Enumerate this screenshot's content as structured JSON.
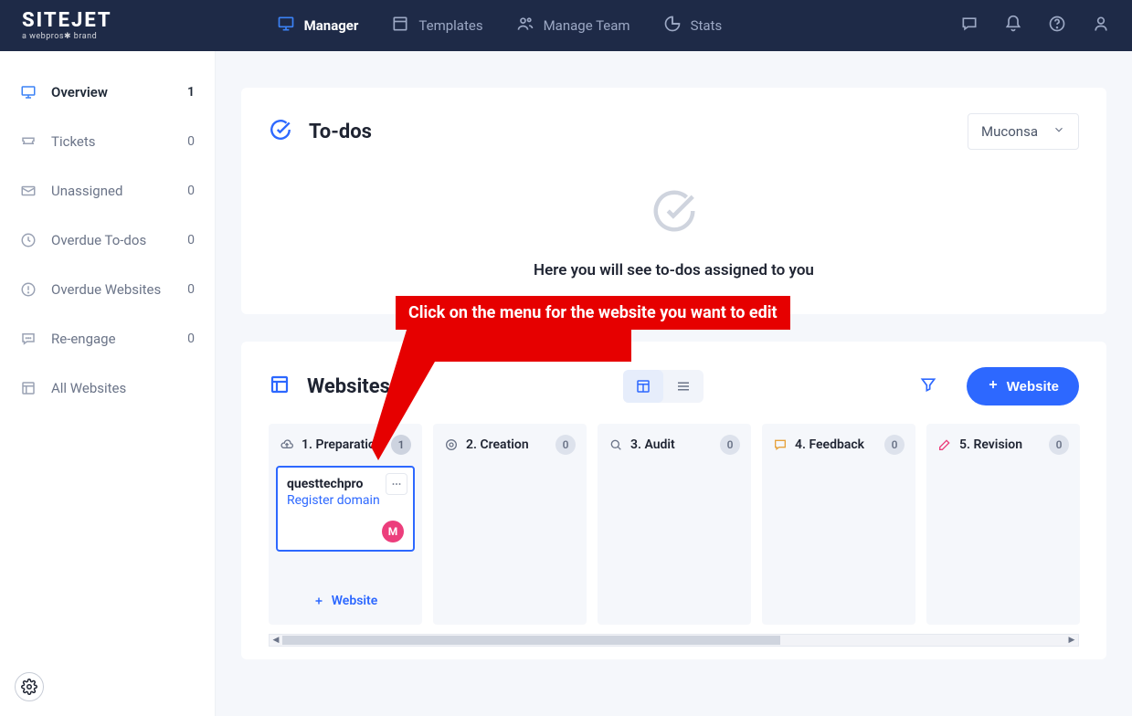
{
  "brand": {
    "name": "SITEJET",
    "sub": "a webpros✱ brand"
  },
  "topnav": {
    "items": [
      {
        "label": "Manager"
      },
      {
        "label": "Templates"
      },
      {
        "label": "Manage Team"
      },
      {
        "label": "Stats"
      }
    ]
  },
  "sidebar": {
    "items": [
      {
        "label": "Overview",
        "count": "1"
      },
      {
        "label": "Tickets",
        "count": "0"
      },
      {
        "label": "Unassigned",
        "count": "0"
      },
      {
        "label": "Overdue To-dos",
        "count": "0"
      },
      {
        "label": "Overdue Websites",
        "count": "0"
      },
      {
        "label": "Re-engage",
        "count": "0"
      },
      {
        "label": "All Websites",
        "count": ""
      }
    ]
  },
  "todos": {
    "title": "To-dos",
    "dropdown": "Muconsa",
    "empty_text": "Here you will see to-dos assigned to you"
  },
  "websites": {
    "title": "Websites",
    "add_button": "Website",
    "add_inline": "Website",
    "columns": [
      {
        "label": "1. Preparation",
        "count": "1"
      },
      {
        "label": "2. Creation",
        "count": "0"
      },
      {
        "label": "3. Audit",
        "count": "0"
      },
      {
        "label": "4. Feedback",
        "count": "0"
      },
      {
        "label": "5. Revision",
        "count": "0"
      }
    ],
    "card": {
      "name": "questtechpro",
      "action": "Register domain",
      "avatar_initial": "M"
    }
  },
  "annotation": {
    "text": "Click on the menu for the website you want to edit"
  }
}
